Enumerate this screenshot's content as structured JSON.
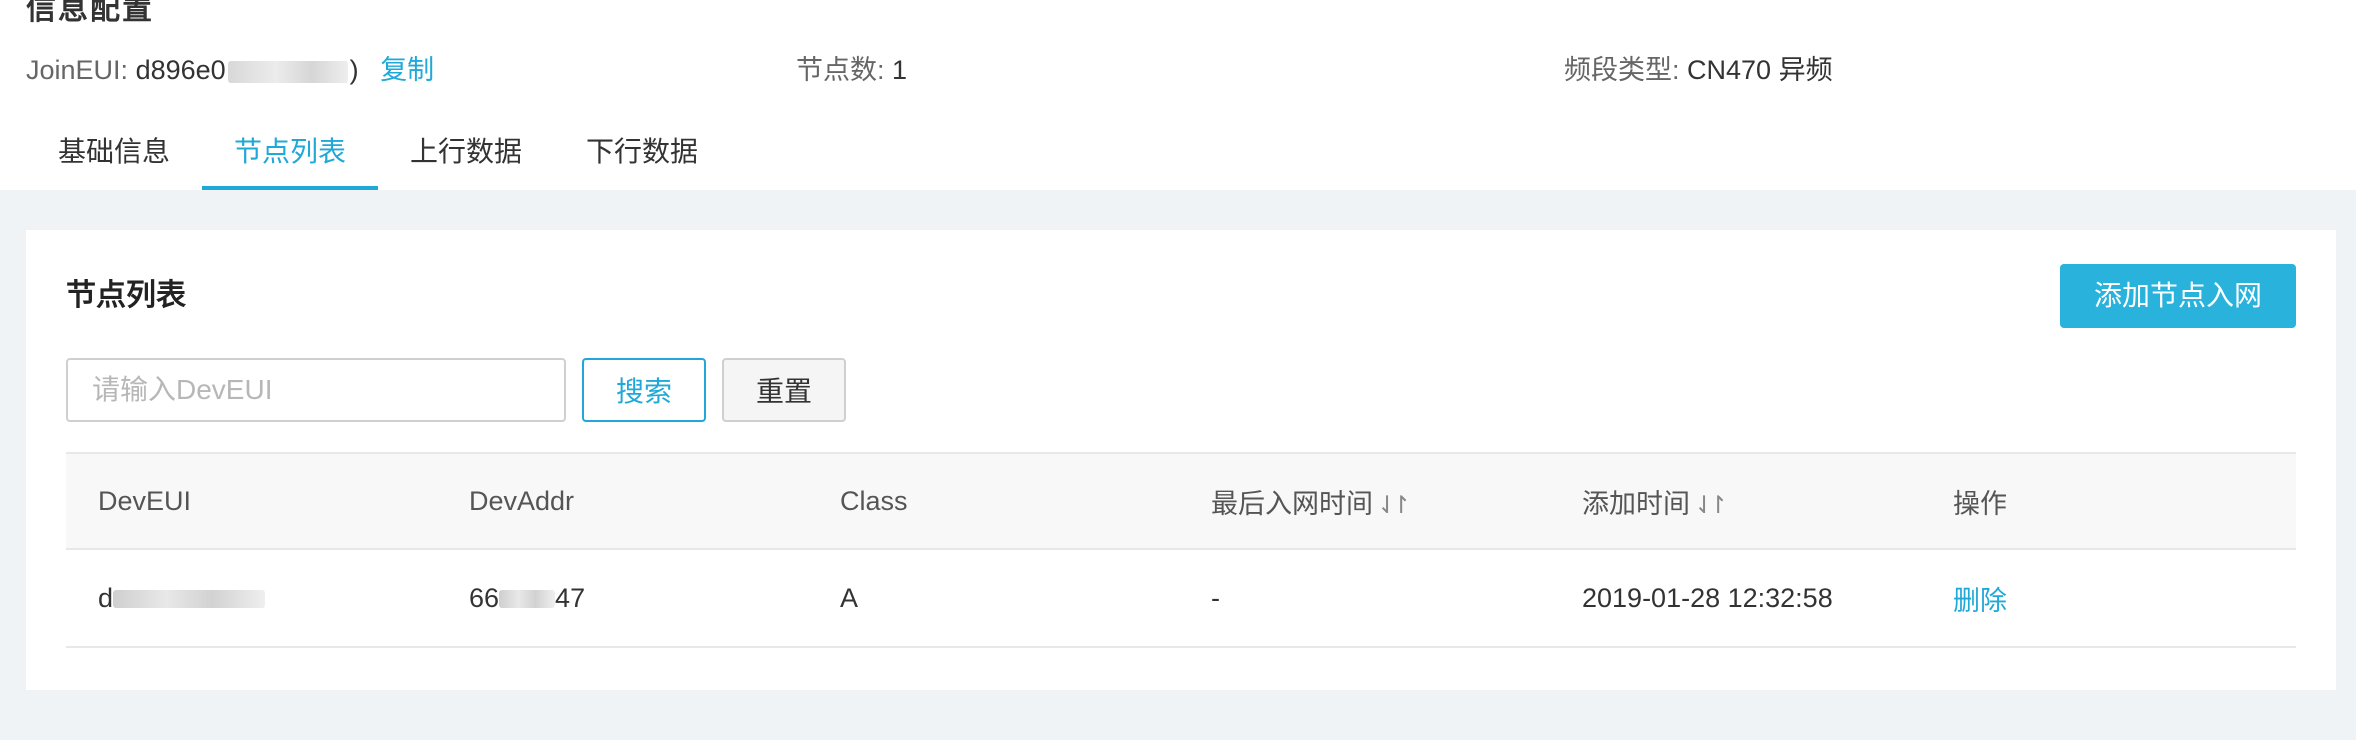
{
  "header": {
    "title_peek": "信息配置",
    "join_eui_label": "JoinEUI:",
    "join_eui_value_start": "d896e0",
    "join_eui_value_end": ")",
    "copy_label": "复制",
    "node_count_label": "节点数:",
    "node_count_value": "1",
    "band_label": "频段类型:",
    "band_value": "CN470 异频"
  },
  "tabs": [
    {
      "label": "基础信息",
      "active": false
    },
    {
      "label": "节点列表",
      "active": true
    },
    {
      "label": "上行数据",
      "active": false
    },
    {
      "label": "下行数据",
      "active": false
    }
  ],
  "card": {
    "title": "节点列表",
    "add_button": "添加节点入网",
    "search_placeholder": "请输入DevEUI",
    "search_button": "搜索",
    "reset_button": "重置"
  },
  "table": {
    "columns": [
      "DevEUI",
      "DevAddr",
      "Class",
      "最后入网时间",
      "添加时间",
      "操作"
    ],
    "sort_icon": "⇃↾",
    "rows": [
      {
        "dev_eui_start": "d",
        "dev_addr_start": "66",
        "dev_addr_end": "47",
        "class": "A",
        "last_join": "-",
        "added": "2019-01-28 12:32:58",
        "action": "删除"
      }
    ]
  },
  "colors": {
    "accent": "#20a8d8",
    "primary_button": "#29b2dc",
    "page_bg": "#f0f3f6"
  }
}
